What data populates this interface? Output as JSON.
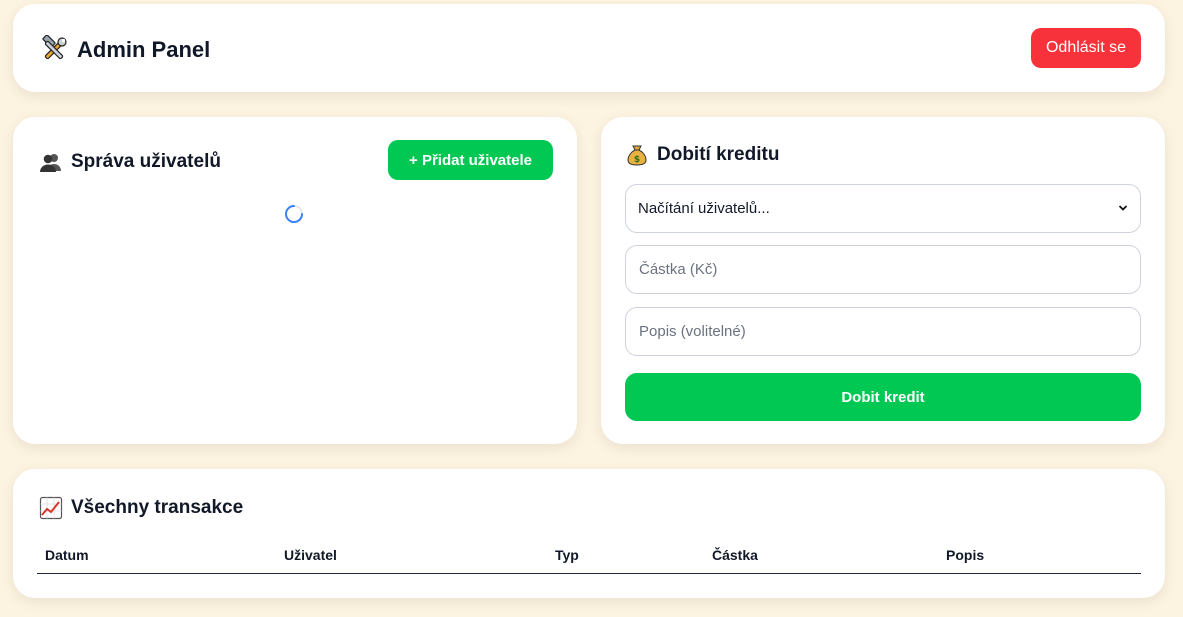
{
  "header": {
    "icon": "tools-icon",
    "title": "Admin Panel",
    "logout_label": "Odhlásit se",
    "logout_color": "#f8323b"
  },
  "users": {
    "icon": "users-icon",
    "title": "Správa uživatelů",
    "add_label": "+ Přidat uživatele",
    "add_color": "#00c853",
    "loading": true
  },
  "credit": {
    "icon": "money-bag-icon",
    "title": "Dobití kreditu",
    "user_select_value": "Načítání uživatelů...",
    "amount_placeholder": "Částka (Kč)",
    "description_placeholder": "Popis (volitelné)",
    "submit_label": "Dobit kredit"
  },
  "transactions": {
    "icon": "chart-up-icon",
    "title": "Všechny transakce",
    "columns": [
      "Datum",
      "Uživatel",
      "Typ",
      "Částka",
      "Popis"
    ]
  },
  "colors": {
    "background": "#fdf3e1",
    "accent_green": "#00c853",
    "danger_red": "#f8323b",
    "spinner_blue": "#3b82f6"
  }
}
